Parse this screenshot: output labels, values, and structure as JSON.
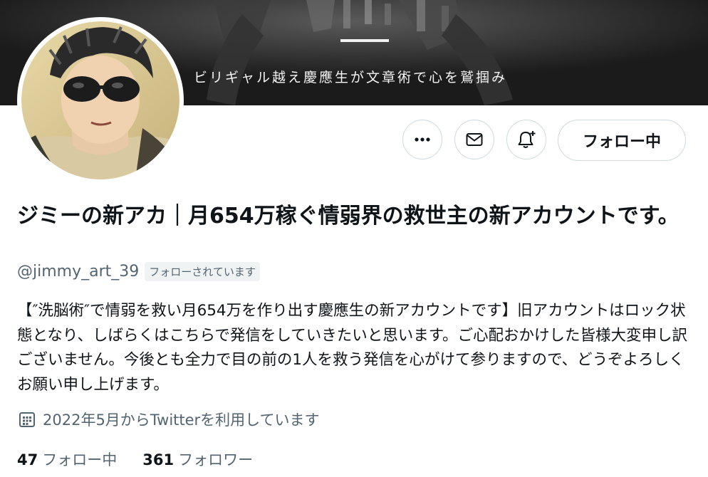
{
  "banner": {
    "tagline": "ビリギャル越え慶應生が文章術で心を鷲掴み"
  },
  "actions": {
    "more_icon": "more-horizontal-icon",
    "message_icon": "envelope-icon",
    "notify_icon": "bell-plus-icon",
    "follow_label": "フォロー中"
  },
  "profile": {
    "display_name": "ジミーの新アカ｜月654万稼ぐ情弱界の救世主の新アカウントです。",
    "handle": "@jimmy_art_39",
    "follows_you": "フォローされています",
    "bio": "【″洗脳術″で情弱を救い月654万を作り出す慶應生の新アカウントです】旧アカウントはロック状態となり、しばらくはこちらで発信をしていきたいと思います。ご心配おかけした皆様大変申し訳ございません。今後とも全力で目の前の1人を救う発信を心がけて参りますので、どうぞよろしくお願い申し上げます。",
    "joined_icon": "calendar-icon",
    "joined": "2022年5月からTwitterを利用しています"
  },
  "stats": {
    "following_count": "47",
    "following_label": "フォロー中",
    "followers_count": "361",
    "followers_label": "フォロワー"
  },
  "colors": {
    "text_primary": "#0f1419",
    "text_secondary": "#536471",
    "border": "#cfd9de",
    "badge_bg": "#eff3f4"
  }
}
